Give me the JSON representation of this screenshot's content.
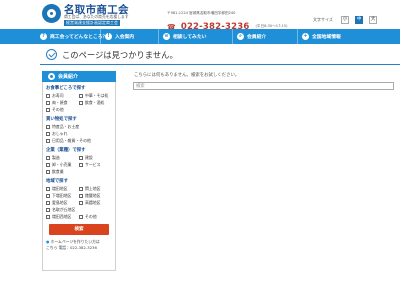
{
  "header": {
    "logo_title": "名取市商工会",
    "logo_sub": "商工会は、あなたの商売を応援します",
    "logo_badge": "経営発達支援計画認定商工会",
    "address": "〒981-1224 宮城県名取市増田字柳田240",
    "tel_icon": "phone-icon",
    "tel": "022-382-3236",
    "tel_hours": "(平日8:30〜17:15)",
    "font_size_label": "文字サイズ",
    "font_sizes": [
      "小",
      "中",
      "大"
    ]
  },
  "nav": [
    {
      "label": "商工会ってどんなところ？",
      "icon": "question-icon",
      "glyph": "?"
    },
    {
      "label": "入会案内",
      "icon": "pointer-icon",
      "glyph": "!"
    },
    {
      "label": "相談してみたい",
      "icon": "chat-icon",
      "glyph": "≡"
    },
    {
      "label": "会員紹介",
      "icon": "search-icon",
      "glyph": "⌕"
    },
    {
      "label": "全国地域情報",
      "icon": "plus-icon",
      "glyph": "+"
    }
  ],
  "page": {
    "title": "このページは見つかりません。",
    "not_found_text": "こちらには何もありません。検索をお試しください。",
    "search_placeholder": "検索"
  },
  "sidebar": {
    "heading": "会員紹介",
    "groups": [
      {
        "title": "お食事どころで探す",
        "options": [
          "お寿司",
          "中華・そば処",
          "肉・焼食",
          "飲食・酒処",
          "その他"
        ]
      },
      {
        "title": "買い物処で探す",
        "options": [
          "特産品・お土産",
          "おしゃれ",
          "日用品・雑貨・その他"
        ]
      },
      {
        "title": "企業（業種）で探す",
        "options": [
          "製造",
          "建設",
          "卸・小売業",
          "サービス",
          "飲食業"
        ]
      },
      {
        "title": "地域で探す",
        "options": [
          "増田地区",
          "閖上地区",
          "下増田地区",
          "館腰地区",
          "愛島地区",
          "高舘地区",
          "名取が丘地区",
          "増田西地区",
          "その他"
        ]
      }
    ],
    "search_button": "検索",
    "footer_line1": "ホームページを作りたい方は",
    "footer_line2": "こちら 電話：022-382-3236"
  },
  "colors": {
    "nav_blue": "#1f8fd8",
    "logo_blue": "#1a4f93",
    "tel_red": "#c0392b",
    "button_orange": "#d9441e"
  }
}
